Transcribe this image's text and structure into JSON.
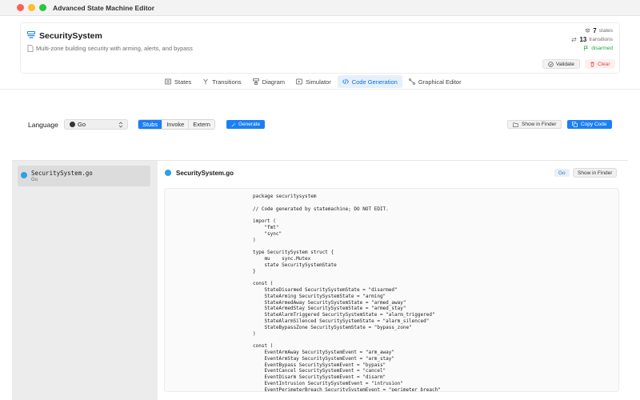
{
  "window": {
    "title": "Advanced State Machine Editor"
  },
  "machine": {
    "name": "SecuritySystem",
    "description": "Multi-zone building security with arming, alerts, and bypass",
    "states_count": "7",
    "states_label": "states",
    "transitions_count": "13",
    "transitions_label": "transitions",
    "initial_state": "disarmed"
  },
  "header_actions": {
    "validate": "Validate",
    "clear": "Clear"
  },
  "tabs": [
    {
      "label": "States",
      "icon": "list-icon"
    },
    {
      "label": "Transitions",
      "icon": "branch-icon"
    },
    {
      "label": "Diagram",
      "icon": "diagram-icon"
    },
    {
      "label": "Simulator",
      "icon": "play-icon"
    },
    {
      "label": "Code Generation",
      "icon": "code-icon",
      "active": true
    },
    {
      "label": "Graphical Editor",
      "icon": "graph-icon"
    }
  ],
  "toolbar": {
    "language_label": "Language",
    "language_value": "Go",
    "modes": [
      "Stubs",
      "Invoke",
      "Extern"
    ],
    "active_mode": "Stubs",
    "generate": "Generate",
    "show_in_finder": "Show in Finder",
    "copy_code": "Copy Code"
  },
  "files": [
    {
      "name": "SecuritySystem.go",
      "language": "Go"
    }
  ],
  "panel": {
    "title": "SecuritySystem.go",
    "badge": "Go",
    "show_in_finder": "Show in Finder"
  },
  "code_lines": [
    "package securitysystem",
    "",
    "// Code generated by statemachine; DO NOT EDIT.",
    "",
    "import (",
    "    \"fmt\"",
    "    \"sync\"",
    ")",
    "",
    "type SecuritySystem struct {",
    "    mu    sync.Mutex",
    "    state SecuritySystemState",
    "}",
    "",
    "const (",
    "    StateDisarmed SecuritySystemState = \"disarmed\"",
    "    StateArming SecuritySystemState = \"arming\"",
    "    StateArmedAway SecuritySystemState = \"armed_away\"",
    "    StateArmedStay SecuritySystemState = \"armed_stay\"",
    "    StateAlarmTriggered SecuritySystemState = \"alarm_triggered\"",
    "    StateAlarmSilenced SecuritySystemState = \"alarm_silenced\"",
    "    StateBypassZone SecuritySystemState = \"bypass_zone\"",
    ")",
    "",
    "const (",
    "    EventArmAway SecuritySystemEvent = \"arm_away\"",
    "    EventArmStay SecuritySystemEvent = \"arm_stay\"",
    "    EventBypass SecuritySystemEvent = \"bypass\"",
    "    EventCancel SecuritySystemEvent = \"cancel\"",
    "    EventDisarm SecuritySystemEvent = \"disarm\"",
    "    EventIntrusion SecuritySystemEvent = \"intrusion\"",
    "    EventPerimeterBreach SecuritySystemEvent = \"perimeter_breach\""
  ],
  "colors": {
    "accent": "#1a7ff5",
    "success": "#28a745",
    "danger": "#e0443e",
    "go_icon": "#2aa1e8"
  }
}
